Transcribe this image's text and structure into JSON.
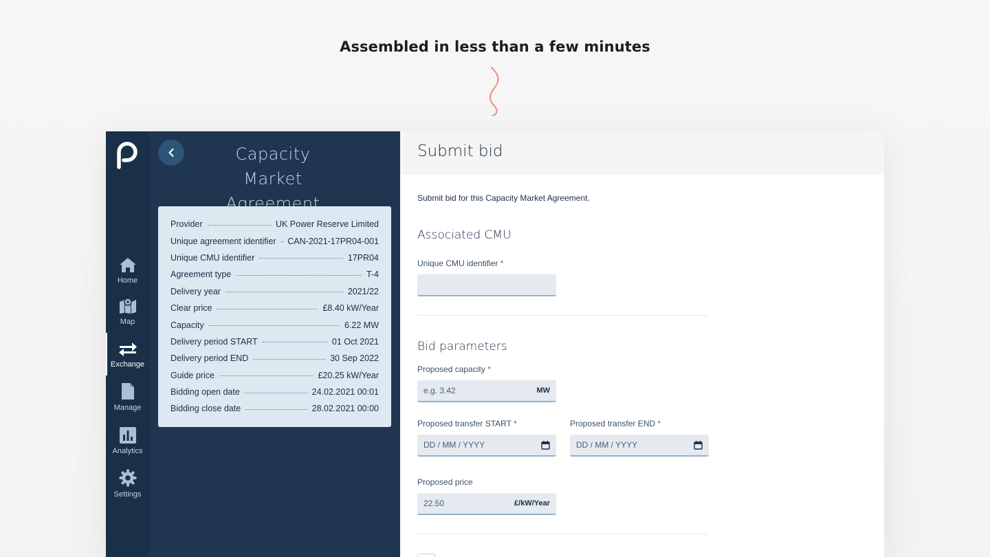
{
  "headline": "Assembled in less than a few minutes",
  "colors": {
    "accent_squiggle": "#ef8f77",
    "rail_bg": "#1a3048",
    "panel_bg": "#1f3550",
    "card_bg": "#dce9f1"
  },
  "nav": {
    "items": [
      {
        "label": "Home",
        "icon": "home-icon"
      },
      {
        "label": "Map",
        "icon": "map-icon"
      },
      {
        "label": "Exchange",
        "icon": "exchange-icon",
        "active": true
      },
      {
        "label": "Manage",
        "icon": "document-icon"
      },
      {
        "label": "Analytics",
        "icon": "analytics-icon"
      },
      {
        "label": "Settings",
        "icon": "gear-icon"
      }
    ]
  },
  "panel": {
    "title": "Capacity Market Agreement",
    "details": [
      {
        "key": "Provider",
        "value": "UK Power Reserve Limited"
      },
      {
        "key": "Unique agreement identifier",
        "value": "CAN-2021-17PR04-001"
      },
      {
        "key": "Unique CMU identifier",
        "value": "17PR04"
      },
      {
        "key": "Agreement type",
        "value": "T-4"
      },
      {
        "key": "Delivery year",
        "value": "2021/22"
      },
      {
        "key": "Clear price",
        "value": "£8.40 kW/Year"
      },
      {
        "key": "Capacity",
        "value": "6.22 MW"
      },
      {
        "key": "Delivery period START",
        "value": "01 Oct 2021"
      },
      {
        "key": "Delivery period END",
        "value": "30 Sep 2022"
      },
      {
        "key": "Guide price",
        "value": "£20.25 kW/Year"
      },
      {
        "key": "Bidding open date",
        "value": "24.02.2021 00:01"
      },
      {
        "key": "Bidding close date",
        "value": "28.02.2021 00:00"
      }
    ]
  },
  "form": {
    "title": "Submit bid",
    "intro": "Submit bid for this Capacity Market Agreement.",
    "cmu_section": "Associated CMU",
    "cmu_label": "Unique CMU identifier",
    "cmu_value": "",
    "bid_section": "Bid parameters",
    "capacity_label": "Proposed capacity",
    "capacity_placeholder": "e.g. 3.42",
    "capacity_unit": "MW",
    "start_label": "Proposed transfer START",
    "start_placeholder": "DD / MM / YYYY",
    "end_label": "Proposed transfer END",
    "end_placeholder": "DD / MM / YYYY",
    "price_label": "Proposed price",
    "price_value": "22.50",
    "price_unit": "£/kW/Year",
    "required_mark": "*"
  }
}
